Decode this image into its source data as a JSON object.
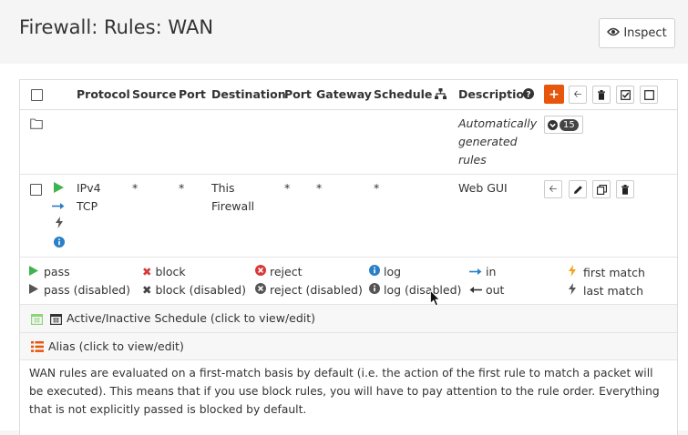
{
  "page": {
    "title": "Firewall: Rules: WAN",
    "inspect_label": "Inspect"
  },
  "table": {
    "headers": {
      "protocol": "Protocol",
      "source": "Source",
      "port": "Port",
      "destination": "Destination",
      "dest_port": "Port",
      "gateway": "Gateway",
      "schedule": "Schedule",
      "description": "Description"
    },
    "auto_group": {
      "description_lines": [
        "Automatically",
        "generated",
        "rules"
      ],
      "count": "15"
    },
    "rule": {
      "protocol_lines": [
        "IPv4",
        "TCP"
      ],
      "source": "*",
      "port": "*",
      "destination_lines": [
        "This",
        "Firewall"
      ],
      "dest_port": "*",
      "gateway": "*",
      "schedule": "*",
      "description": "Web GUI"
    }
  },
  "legend": {
    "pass": "pass",
    "pass_disabled": "pass (disabled)",
    "block": "block",
    "block_disabled": "block (disabled)",
    "reject": "reject",
    "reject_disabled": "reject (disabled)",
    "log": "log",
    "log_disabled": "log (disabled)",
    "in": "in",
    "out": "out",
    "first_match": "first match",
    "last_match": "last match",
    "schedule": "Active/Inactive Schedule (click to view/edit)",
    "alias": "Alias (click to view/edit)"
  },
  "note": "WAN rules are evaluated on a first-match basis by default (i.e. the action of the first rule to match a packet will be executed). This means that if you use block rules, you will have to pay attention to the rule order. Everything that is not explicitly passed is blocked by default.",
  "colors": {
    "accent": "#e6560c",
    "pass": "#3fb34f",
    "block": "#d9383a",
    "info": "#2a7fc5",
    "match": "#f0a31c"
  }
}
